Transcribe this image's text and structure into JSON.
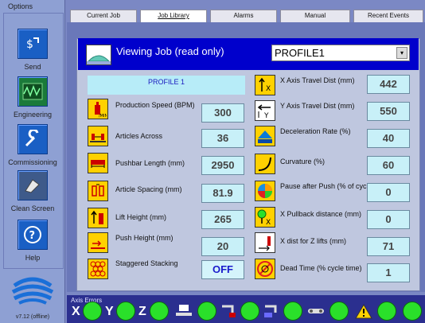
{
  "sidebar": {
    "options_label": "Options",
    "buttons": [
      {
        "label": "Send",
        "icon": "send-icon"
      },
      {
        "label": "Engineering",
        "icon": "engineering-icon"
      },
      {
        "label": "Commissioning",
        "icon": "commissioning-icon"
      },
      {
        "label": "Clean Screen",
        "icon": "clean-screen-icon"
      },
      {
        "label": "Help",
        "icon": "help-icon"
      }
    ],
    "version": "v7.12 (offline)"
  },
  "tabs": [
    {
      "label": "Current Job",
      "active": false
    },
    {
      "label": "Job Library",
      "active": true
    },
    {
      "label": "Alarms",
      "active": false
    },
    {
      "label": "Manual",
      "active": false
    },
    {
      "label": "Recent Events",
      "active": false
    }
  ],
  "header": {
    "title": "Viewing Job (read only)",
    "selected_job": "PROFILE1"
  },
  "profile_name": "PROFILE 1",
  "left_params": [
    {
      "label": "Production Speed (BPM)",
      "value": "300",
      "icon": "production-speed-icon"
    },
    {
      "label": "Articles Across",
      "value": "36",
      "icon": "articles-across-icon"
    },
    {
      "label": "Pushbar Length (mm)",
      "value": "2950",
      "icon": "pushbar-length-icon"
    },
    {
      "label": "Article Spacing (mm)",
      "value": "81.9",
      "icon": "article-spacing-icon"
    },
    {
      "label": "Lift Height (mm)",
      "value": "265",
      "icon": "lift-height-icon"
    },
    {
      "label": "Push Height (mm)",
      "value": "20",
      "icon": "push-height-icon"
    },
    {
      "label": "Staggered Stacking",
      "value": "OFF",
      "icon": "staggered-stacking-icon"
    }
  ],
  "right_params": [
    {
      "label": "X Axis Travel Dist (mm)",
      "value": "442",
      "icon": "x-axis-travel-icon"
    },
    {
      "label": "Y Axis Travel Dist (mm)",
      "value": "550",
      "icon": "y-axis-travel-icon"
    },
    {
      "label": "Deceleration Rate (%)",
      "value": "40",
      "icon": "deceleration-rate-icon"
    },
    {
      "label": "Curvature (%)",
      "value": "60",
      "icon": "curvature-icon"
    },
    {
      "label": "Pause after Push (% of cycle time)",
      "value": "0",
      "icon": "pause-after-push-icon"
    },
    {
      "label": "X Pullback distance (mm)",
      "value": "0",
      "icon": "x-pullback-icon"
    },
    {
      "label": "X dist for Z lifts (mm)",
      "value": "71",
      "icon": "x-dist-z-lifts-icon"
    },
    {
      "label": "Dead Time (% cycle time)",
      "value": "1",
      "icon": "dead-time-icon"
    }
  ],
  "axis_errors": {
    "label": "Axis Errors",
    "axes": [
      "X",
      "Y",
      "Z"
    ],
    "status_color": "#2ae02a"
  },
  "colors": {
    "header_blue": "#0000cc",
    "value_box": "#c8f0f8",
    "icon_yellow": "#ffd100"
  }
}
